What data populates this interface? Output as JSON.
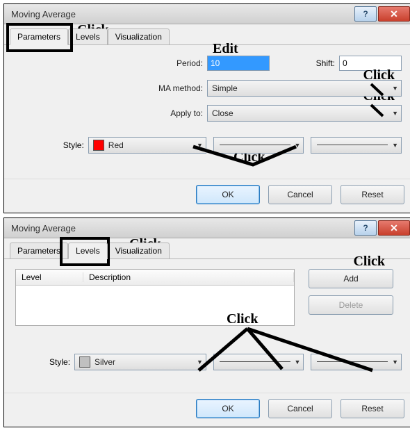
{
  "dialog1": {
    "title": "Moving Average",
    "tabs": {
      "parameters": "Parameters",
      "levels": "Levels",
      "visualization": "Visualization"
    },
    "labels": {
      "period": "Period:",
      "shift": "Shift:",
      "method": "MA method:",
      "apply": "Apply to:",
      "style": "Style:"
    },
    "values": {
      "period": "10",
      "shift": "0",
      "method": "Simple",
      "apply": "Close",
      "style_color": "Red"
    },
    "colors": {
      "swatch": "#ff0000"
    },
    "buttons": {
      "ok": "OK",
      "cancel": "Cancel",
      "reset": "Reset"
    },
    "annot": {
      "click_tab": "Click",
      "edit": "Edit",
      "click_method": "Click",
      "click_apply": "Click",
      "click_style": "Click"
    }
  },
  "dialog2": {
    "title": "Moving Average",
    "tabs": {
      "parameters": "Parameters",
      "levels": "Levels",
      "visualization": "Visualization"
    },
    "list": {
      "col_level": "Level",
      "col_desc": "Description"
    },
    "labels": {
      "style": "Style:"
    },
    "values": {
      "style_color": "Silver"
    },
    "colors": {
      "swatch": "#c0c0c0"
    },
    "side": {
      "add": "Add",
      "delete": "Delete"
    },
    "buttons": {
      "ok": "OK",
      "cancel": "Cancel",
      "reset": "Reset"
    },
    "annot": {
      "click_tab": "Click",
      "click_add": "Click",
      "click_style": "Click"
    }
  }
}
